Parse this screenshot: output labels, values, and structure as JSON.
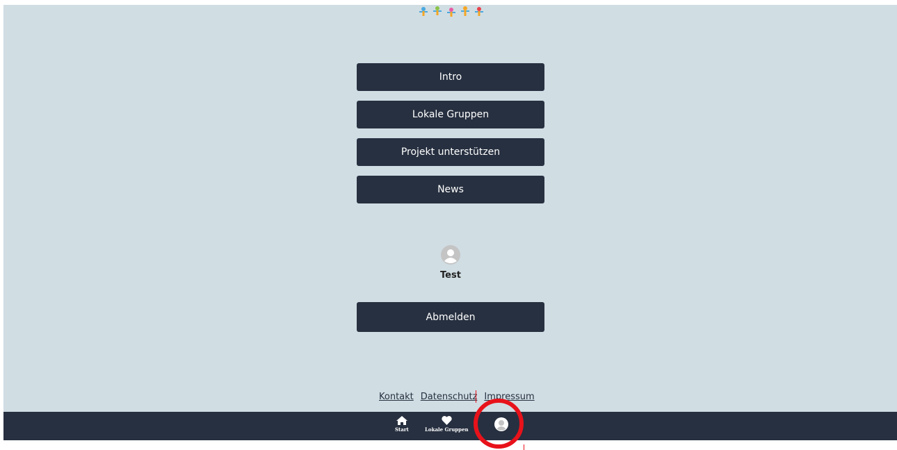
{
  "menu": {
    "intro": "Intro",
    "local_groups": "Lokale Gruppen",
    "support_project": "Projekt unterstützen",
    "news": "News"
  },
  "profile": {
    "username": "Test",
    "logout_label": "Abmelden"
  },
  "footer": {
    "contact": "Kontakt",
    "privacy": "Datenschutz",
    "imprint": "Impressum"
  },
  "bottom_nav": {
    "items": [
      {
        "label": "Start",
        "icon": "home-icon"
      },
      {
        "label": "Lokale Gruppen",
        "icon": "heart-icon"
      },
      {
        "label": "",
        "icon": "user-avatar-icon"
      }
    ]
  },
  "colors": {
    "page_background": "#d0dde3",
    "button": "#273040",
    "nav_bar": "#273040",
    "highlight": "#e8121a"
  }
}
